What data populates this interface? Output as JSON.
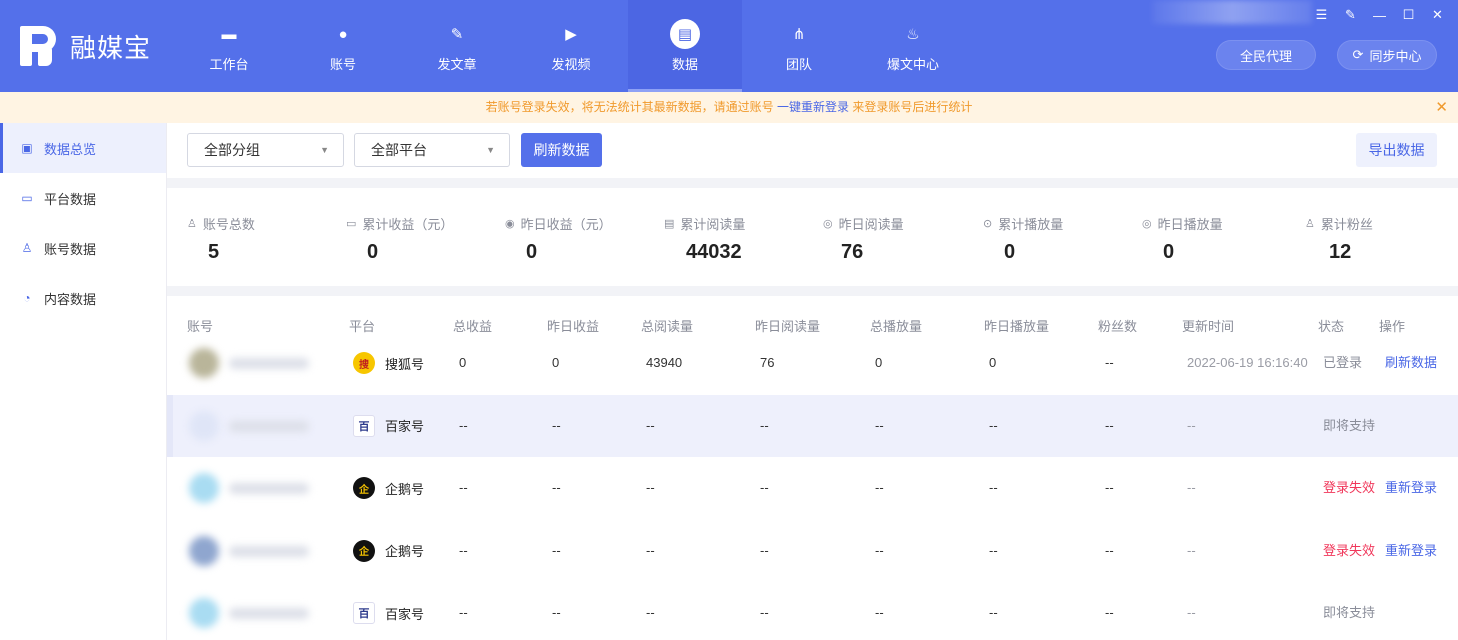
{
  "app": {
    "logo_text": "融媒宝",
    "window_controls": [
      "menu-icon",
      "edit-icon",
      "minimize-icon",
      "maximize-icon",
      "close-icon"
    ]
  },
  "nav": {
    "items": [
      {
        "label": "工作台",
        "icon": "monitor-icon",
        "glyph": "▬"
      },
      {
        "label": "账号",
        "icon": "user-icon",
        "glyph": "●"
      },
      {
        "label": "发文章",
        "icon": "feather-icon",
        "glyph": "✎"
      },
      {
        "label": "发视频",
        "icon": "play-icon",
        "glyph": "▶"
      },
      {
        "label": "数据",
        "icon": "chart-icon",
        "glyph": "▤"
      },
      {
        "label": "团队",
        "icon": "team-tree-icon",
        "glyph": "⋔"
      },
      {
        "label": "爆文中心",
        "icon": "fire-icon",
        "glyph": "♨"
      }
    ],
    "active_index": 4
  },
  "header_buttons": {
    "agent": "全民代理",
    "sync": "同步中心"
  },
  "notice": {
    "text_before": "若账号登录失效，将无法统计其最新数据，请通过账号 ",
    "link": "一键重新登录",
    "text_after": " 来登录账号后进行统计"
  },
  "sidebar": {
    "items": [
      {
        "label": "数据总览",
        "icon": "dashboard-icon",
        "glyph": "▣"
      },
      {
        "label": "平台数据",
        "icon": "monitor-icon",
        "glyph": "▭"
      },
      {
        "label": "账号数据",
        "icon": "user-icon",
        "glyph": "♙"
      },
      {
        "label": "内容数据",
        "icon": "pie-chart-icon",
        "glyph": "◔"
      }
    ],
    "active_index": 0
  },
  "filters": {
    "group": "全部分组",
    "platform": "全部平台",
    "refresh": "刷新数据",
    "export": "导出数据"
  },
  "stats": [
    {
      "label": "账号总数",
      "icon": "user-icon",
      "glyph": "♙",
      "value": "5"
    },
    {
      "label": "累计收益（元）",
      "icon": "wallet-icon",
      "glyph": "▭",
      "value": "0"
    },
    {
      "label": "昨日收益（元）",
      "icon": "coin-icon",
      "glyph": "◉",
      "value": "0"
    },
    {
      "label": "累计阅读量",
      "icon": "document-icon",
      "glyph": "▤",
      "value": "44032"
    },
    {
      "label": "昨日阅读量",
      "icon": "eye-icon",
      "glyph": "◎",
      "value": "76"
    },
    {
      "label": "累计播放量",
      "icon": "play-circle-icon",
      "glyph": "⊙",
      "value": "0"
    },
    {
      "label": "昨日播放量",
      "icon": "play-circle-icon",
      "glyph": "◎",
      "value": "0"
    },
    {
      "label": "累计粉丝",
      "icon": "fans-icon",
      "glyph": "♙",
      "value": "12"
    }
  ],
  "table": {
    "columns": [
      "账号",
      "平台",
      "总收益",
      "昨日收益",
      "总阅读量",
      "昨日阅读量",
      "总播放量",
      "昨日播放量",
      "粉丝数",
      "更新时间",
      "状态",
      "操作"
    ],
    "rows": [
      {
        "platform": "搜狐号",
        "platform_icon": "sohu-icon",
        "total_income": "0",
        "yesterday_income": "0",
        "total_reads": "43940",
        "yesterday_reads": "76",
        "total_plays": "0",
        "yesterday_plays": "0",
        "fans": "--",
        "updated": "2022-06-19 16:16:40",
        "status": "已登录",
        "status_color": "gray",
        "action": "刷新数据",
        "avatar_color": "#b9b59a"
      },
      {
        "platform": "百家号",
        "platform_icon": "baidu-icon",
        "total_income": "--",
        "yesterday_income": "--",
        "total_reads": "--",
        "yesterday_reads": "--",
        "total_plays": "--",
        "yesterday_plays": "--",
        "fans": "--",
        "updated": "--",
        "status": "即将支持",
        "status_color": "gray",
        "action": "",
        "avatar_color": "#dfe5f7"
      },
      {
        "platform": "企鹅号",
        "platform_icon": "penguin-icon",
        "total_income": "--",
        "yesterday_income": "--",
        "total_reads": "--",
        "yesterday_reads": "--",
        "total_plays": "--",
        "yesterday_plays": "--",
        "fans": "--",
        "updated": "--",
        "status": "登录失效",
        "status_color": "red",
        "action": "重新登录",
        "avatar_color": "#a9dcf2"
      },
      {
        "platform": "企鹅号",
        "platform_icon": "penguin-icon",
        "total_income": "--",
        "yesterday_income": "--",
        "total_reads": "--",
        "yesterday_reads": "--",
        "total_plays": "--",
        "yesterday_plays": "--",
        "fans": "--",
        "updated": "--",
        "status": "登录失效",
        "status_color": "red",
        "action": "重新登录",
        "avatar_color": "#8fa6cf"
      },
      {
        "platform": "百家号",
        "platform_icon": "baidu-icon",
        "total_income": "--",
        "yesterday_income": "--",
        "total_reads": "--",
        "yesterday_reads": "--",
        "total_plays": "--",
        "yesterday_plays": "--",
        "fans": "--",
        "updated": "--",
        "status": "即将支持",
        "status_color": "gray",
        "action": "",
        "avatar_color": "#a9dcf2"
      }
    ]
  },
  "colors": {
    "brand": "#5470ea",
    "link": "#4a67e6",
    "danger": "#f0375a",
    "notice_text": "#f09a2d",
    "notice_bg": "#fff4e3"
  }
}
